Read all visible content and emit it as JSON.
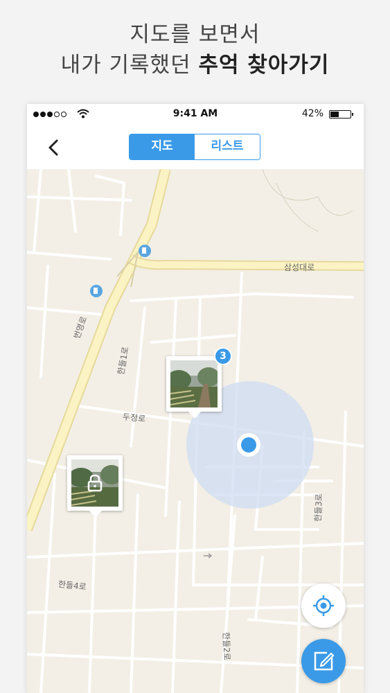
{
  "headline": {
    "line1": "지도를 보면서",
    "line2_prefix": "내가 기록했던 ",
    "line2_bold": "추억 찾아가기"
  },
  "status_bar": {
    "time": "9:41 AM",
    "battery_percent": "42%",
    "battery_level": 0.42,
    "signal_bars_filled": 3,
    "signal_bars_total": 5
  },
  "nav": {
    "tabs": [
      {
        "label": "지도",
        "selected": true
      },
      {
        "label": "리스트",
        "selected": false
      }
    ]
  },
  "map": {
    "road_labels": [
      "삼성대로",
      "번영로",
      "한들1로",
      "두정로",
      "한들3로",
      "한들4로",
      "한들2로"
    ],
    "memory_pins": [
      {
        "count": "3",
        "locked": false
      },
      {
        "locked": true
      }
    ]
  },
  "colors": {
    "accent": "#3a9ae8",
    "map_background": "#f3efe6",
    "major_road": "#fbf3c4",
    "location_halo": "#cfdcf1"
  },
  "icons": {
    "back": "chevron-left-icon",
    "location": "target-location-icon",
    "write": "edit-note-icon",
    "lock": "lock-icon",
    "gas_station": "gas-station-icon"
  }
}
